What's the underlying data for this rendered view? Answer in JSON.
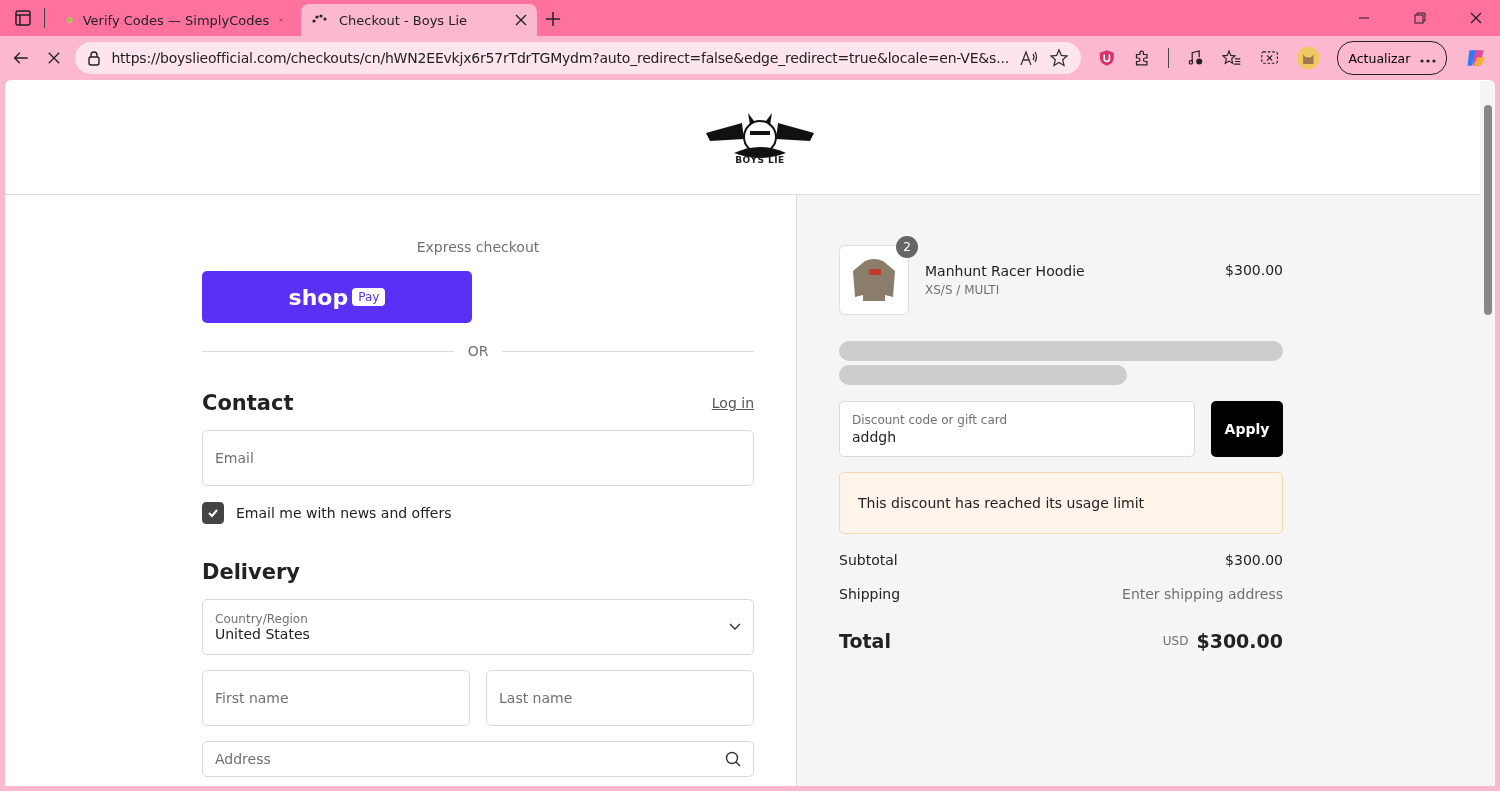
{
  "browser": {
    "tabs": [
      {
        "title": "Verify Codes — SimplyCodes",
        "selected": false
      },
      {
        "title": "Checkout - Boys Lie",
        "selected": true
      }
    ],
    "address": "https://boyslieofficial.com/checkouts/cn/hWN2EEvkjx6r57rTdrTGMydm?auto_redirect=false&edge_redirect=true&locale=en-VE&s...",
    "update_button": "Actualizar"
  },
  "header": {
    "brand": "BOYS LIE"
  },
  "checkout": {
    "express_label": "Express checkout",
    "shop_pay": {
      "shop": "shop",
      "pay": "Pay"
    },
    "divider": "OR",
    "contact": {
      "heading": "Contact",
      "login": "Log in",
      "email_placeholder": "Email",
      "news_checkbox": {
        "label": "Email me with news and offers",
        "checked": true
      }
    },
    "delivery": {
      "heading": "Delivery",
      "country": {
        "label": "Country/Region",
        "value": "United States"
      },
      "first_name_placeholder": "First name",
      "last_name_placeholder": "Last name",
      "address_placeholder": "Address"
    }
  },
  "summary": {
    "item": {
      "quantity": "2",
      "name": "Manhunt Racer Hoodie",
      "variant": "XS/S / MULTI",
      "price": "$300.00"
    },
    "discount": {
      "label": "Discount code or gift card",
      "value": "addgh",
      "apply": "Apply"
    },
    "notice": "This discount has reached its usage limit",
    "subtotal": {
      "label": "Subtotal",
      "value": "$300.00"
    },
    "shipping": {
      "label": "Shipping",
      "value": "Enter shipping address"
    },
    "total": {
      "label": "Total",
      "currency": "USD",
      "value": "$300.00"
    }
  }
}
